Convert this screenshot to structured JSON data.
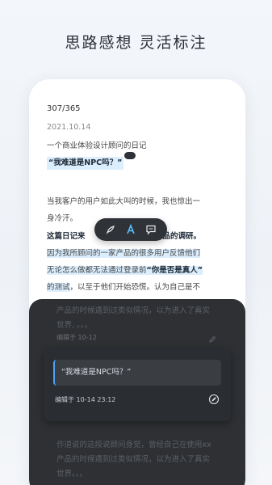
{
  "headline": "思路感想 灵活标注",
  "reader": {
    "progress": "307/365",
    "date": "2021.10.14",
    "book_title": "一个商业体验设计顾问的日记",
    "quote": "“我难道是NPC吗？”",
    "para2_line1": "当我客户的用户如此大叫的时候，我也惊出一",
    "para2_line2": "身冷汗。",
    "para3_bold_a": "这篇日记来",
    "para3_bold_b": "品的调研。",
    "para3_hl_1": "因为我所顾问的一家产品的很多用户反馈他们",
    "para3_hl_2a": "无论怎么做都无法通过登录前",
    "para3_hl_2b": "“你是否是真人”",
    "para3_hl_3": "的测试",
    "para3_tail": "，以至于他们开始恐慌。认为自己是不"
  },
  "toolbar": {
    "pen_icon": "pen-icon",
    "highlight_icon": "text-highlight-icon",
    "comment_icon": "comment-icon"
  },
  "notes": {
    "ghost_top_line1": "产品的时候遇到过类似情况，以为进入了真实",
    "ghost_top_line2": "世界, 。。。",
    "ghost_top_meta": "编辑于 10-12",
    "card_quote": "“我难道是NPC吗？”",
    "card_meta": "编辑于 10-14 23:12",
    "ghost_bottom_line1": "作道说的这段说顾问身觉，曾经自己在使用xx",
    "ghost_bottom_line2": "产品的时候遇到过类似情况，以为进入了真实",
    "ghost_bottom_line3": "世界。。。"
  },
  "colors": {
    "highlight": "#dbeefe",
    "accent": "#4ea3f5",
    "sheet": "#1e2024",
    "toolbar": "#2f3338"
  }
}
